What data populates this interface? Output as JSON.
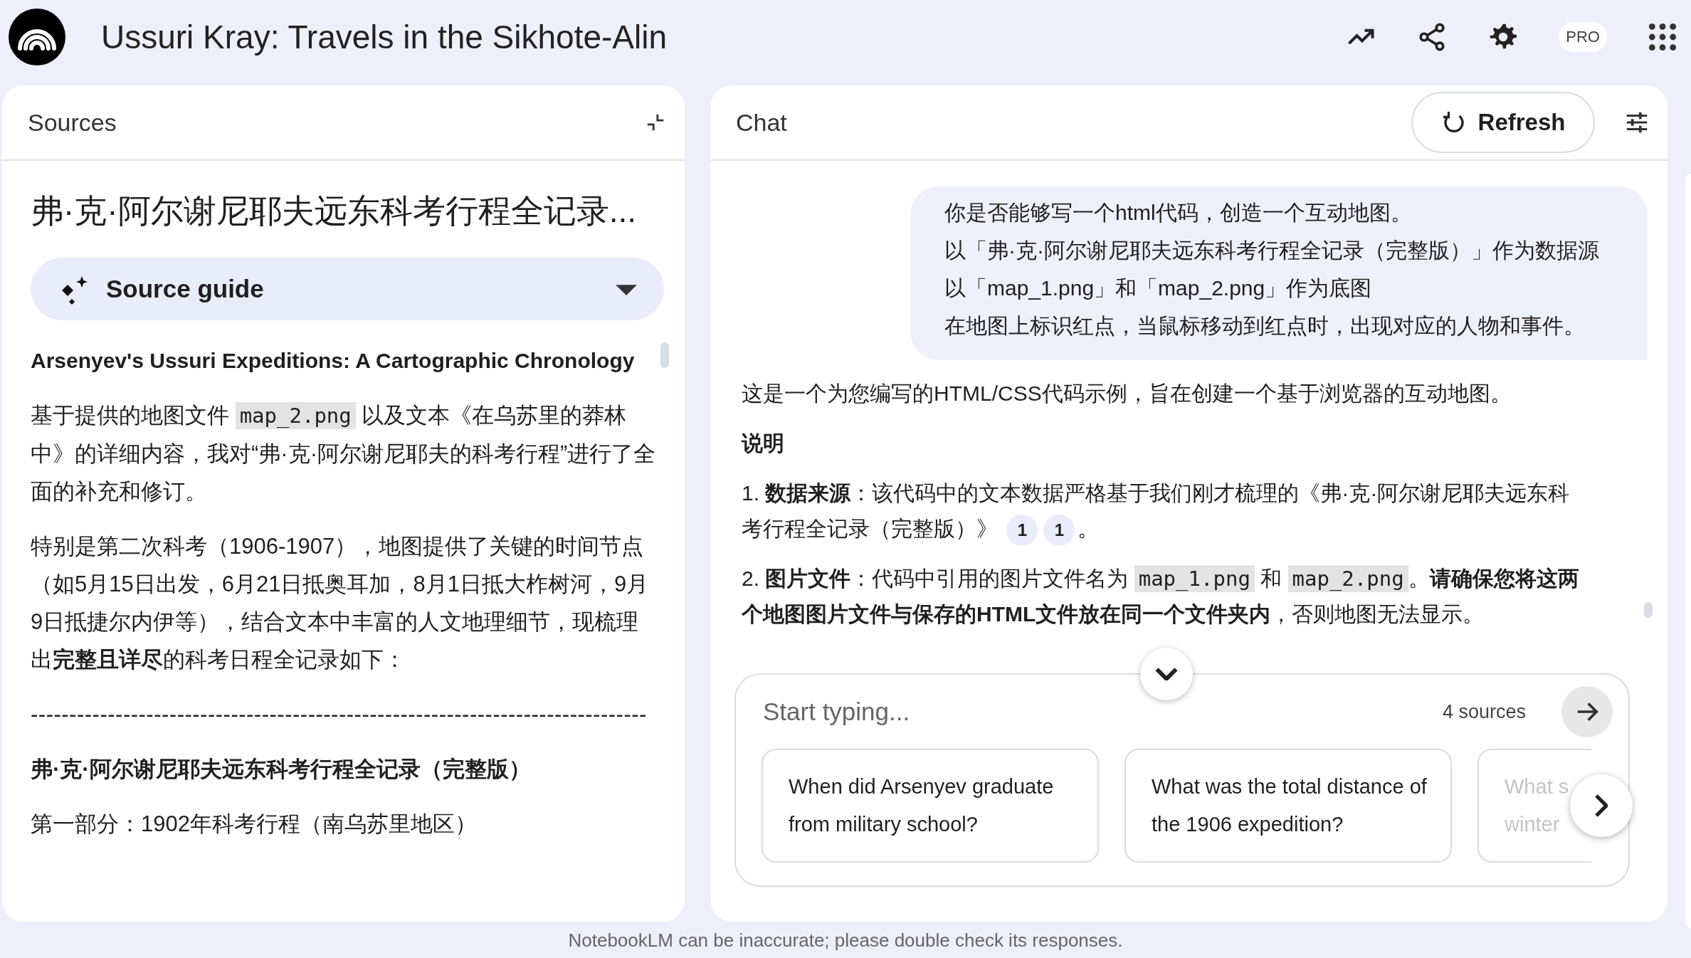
{
  "header": {
    "title": "Ussuri Kray: Travels in the Sikhote-Alin",
    "badge": "PRO"
  },
  "sources": {
    "heading": "Sources",
    "doc_title": "弗·克·阿尔谢尼耶夫远东科考行程全记录...",
    "guide_label": "Source guide",
    "guide_expanded": false,
    "content": [
      {
        "kind": "heading",
        "parts": [
          {
            "kind": "text",
            "text": "Arsenyev's Ussuri Expeditions: A Cartographic Chronology"
          }
        ]
      },
      {
        "kind": "para",
        "parts": [
          {
            "kind": "text",
            "text": "基于提供的地图文件 "
          },
          {
            "kind": "code",
            "text": "map_2.png"
          },
          {
            "kind": "text",
            "text": " 以及文本《在乌苏里的莽林中》的详细内容，我对“弗·克·阿尔谢尼耶夫的科考行程”进行了全面的补充和修订。"
          }
        ]
      },
      {
        "kind": "para",
        "parts": [
          {
            "kind": "text",
            "text": "特别是第二次科考（1906-1907），地图提供了关键的时间节点（如5月15日出发，6月21日抵奥耳加，8月1日抵大柞树河，9月9日抵捷尔内伊等），结合文本中丰富的人文地理细节，现梳理出**完整且详尽**的科考日程全记录如下："
          }
        ]
      },
      {
        "kind": "rule",
        "parts": [
          {
            "kind": "text",
            "text": "--------------------------------------------------------------------------------"
          }
        ]
      },
      {
        "kind": "heading",
        "parts": [
          {
            "kind": "text",
            "text": "弗·克·阿尔谢尼耶夫远东科考行程全记录（完整版）"
          }
        ]
      },
      {
        "kind": "para",
        "parts": [
          {
            "kind": "text",
            "text": "第一部分：1902年科考行程（南乌苏里地区）"
          }
        ]
      }
    ]
  },
  "chat": {
    "heading": "Chat",
    "refresh_label": "Refresh",
    "user_message": [
      "你是否能够写一个html代码，创造一个互动地图。",
      "以「弗·克·阿尔谢尼耶夫远东科考行程全记录（完整版）」作为数据源",
      "以「map_1.png」和「map_2.png」作为底图",
      "在地图上标识红点，当鼠标移动到红点时，出现对应的人物和事件。"
    ],
    "response": [
      {
        "kind": "para",
        "parts": [
          {
            "kind": "text",
            "text": "这是一个为您编写的HTML/CSS代码示例，旨在创建一个基于浏览器的互动地图。"
          }
        ]
      },
      {
        "kind": "heading",
        "parts": [
          {
            "kind": "text",
            "text": "说明"
          }
        ]
      },
      {
        "kind": "para",
        "parts": [
          {
            "kind": "text",
            "text": "1. **数据来源**：该代码中的文本数据严格基于我们刚才梳理的《弗·克·阿尔谢尼耶夫远东科考行程全记录（完整版）》 "
          },
          {
            "kind": "cite",
            "text": "1"
          },
          {
            "kind": "cite",
            "text": "1"
          },
          {
            "kind": "text",
            "text": "。"
          }
        ]
      },
      {
        "kind": "para",
        "parts": [
          {
            "kind": "text",
            "text": "2. **图片文件**：代码中引用的图片文件名为 "
          },
          {
            "kind": "code",
            "text": "map_1.png"
          },
          {
            "kind": "text",
            "text": " 和 "
          },
          {
            "kind": "code",
            "text": "map_2.png"
          },
          {
            "kind": "text",
            "text": "。**请确保您将这两个地图图片文件与保存的HTML文件放在同一个文件夹内**，否则地图无法显示。"
          }
        ]
      }
    ],
    "input": {
      "placeholder": "Start typing...",
      "source_count": "4 sources"
    },
    "suggestions": [
      {
        "text": "When did Arsenyev graduate from military school?",
        "faded": false
      },
      {
        "text": "What was the total distance of the 1906 expedition?",
        "faded": false
      },
      {
        "text": "What s winter",
        "faded": true
      }
    ]
  },
  "footer": "NotebookLM can be inaccurate; please double check its responses."
}
